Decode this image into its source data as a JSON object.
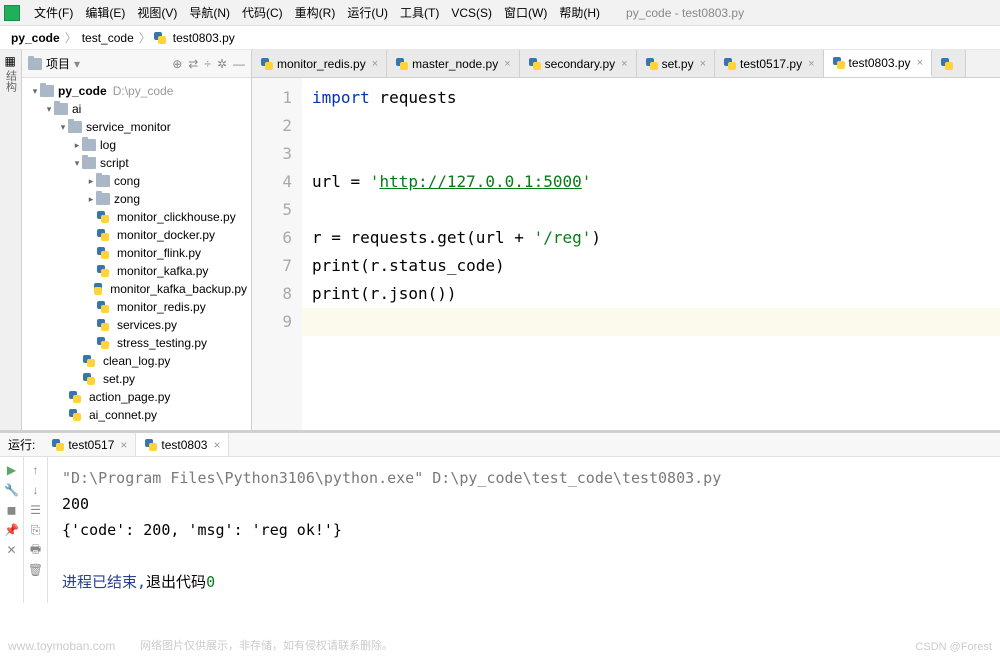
{
  "window_title": "py_code - test0803.py",
  "menu": [
    "文件(F)",
    "编辑(E)",
    "视图(V)",
    "导航(N)",
    "代码(C)",
    "重构(R)",
    "运行(U)",
    "工具(T)",
    "VCS(S)",
    "窗口(W)",
    "帮助(H)"
  ],
  "breadcrumbs": {
    "root": "py_code",
    "mid": "test_code",
    "file": "test0803.py"
  },
  "sidebar": {
    "title": "项目",
    "root_label": "py_code",
    "root_hint": "D:\\py_code",
    "rows": [
      {
        "pad": 1,
        "arrow": "▾",
        "type": "folder",
        "label": "ai"
      },
      {
        "pad": 2,
        "arrow": "▾",
        "type": "folder",
        "label": "service_monitor"
      },
      {
        "pad": 3,
        "arrow": "▸",
        "type": "folder",
        "label": "log"
      },
      {
        "pad": 3,
        "arrow": "▾",
        "type": "folder",
        "label": "script"
      },
      {
        "pad": 4,
        "arrow": "▸",
        "type": "folder",
        "label": "cong"
      },
      {
        "pad": 4,
        "arrow": "▸",
        "type": "folder",
        "label": "zong"
      },
      {
        "pad": 4,
        "arrow": "",
        "type": "py",
        "label": "monitor_clickhouse.py"
      },
      {
        "pad": 4,
        "arrow": "",
        "type": "py",
        "label": "monitor_docker.py"
      },
      {
        "pad": 4,
        "arrow": "",
        "type": "py",
        "label": "monitor_flink.py"
      },
      {
        "pad": 4,
        "arrow": "",
        "type": "py",
        "label": "monitor_kafka.py"
      },
      {
        "pad": 4,
        "arrow": "",
        "type": "py",
        "label": "monitor_kafka_backup.py"
      },
      {
        "pad": 4,
        "arrow": "",
        "type": "py",
        "label": "monitor_redis.py"
      },
      {
        "pad": 4,
        "arrow": "",
        "type": "py",
        "label": "services.py"
      },
      {
        "pad": 4,
        "arrow": "",
        "type": "py",
        "label": "stress_testing.py"
      },
      {
        "pad": 3,
        "arrow": "",
        "type": "py",
        "label": "clean_log.py"
      },
      {
        "pad": 3,
        "arrow": "",
        "type": "py",
        "label": "set.py"
      },
      {
        "pad": 2,
        "arrow": "",
        "type": "py",
        "label": "action_page.py"
      },
      {
        "pad": 2,
        "arrow": "",
        "type": "py",
        "label": "ai_connet.py"
      }
    ]
  },
  "tabs": [
    {
      "label": "monitor_redis.py",
      "active": false
    },
    {
      "label": "master_node.py",
      "active": false
    },
    {
      "label": "secondary.py",
      "active": false
    },
    {
      "label": "set.py",
      "active": false
    },
    {
      "label": "test0517.py",
      "active": false
    },
    {
      "label": "test0803.py",
      "active": true
    }
  ],
  "code": {
    "lines": [
      "1",
      "2",
      "3",
      "4",
      "5",
      "6",
      "7",
      "8",
      "9"
    ],
    "l1_kw": "import",
    "l1_rest": " requests",
    "l4_pre": "url = ",
    "l4_q": "'",
    "l4_url": "http://127.0.0.1:5000",
    "l6_pre": "r = requests.get(url + ",
    "l6_str": "'/reg'",
    "l6_post": ")",
    "l7_fn": "print",
    "l7_arg": "(r.status_code)",
    "l8_fn": "print",
    "l8_arg": "(r.json())"
  },
  "run": {
    "label": "运行:",
    "tabs": [
      {
        "label": "test0517",
        "active": false
      },
      {
        "label": "test0803",
        "active": true
      }
    ],
    "cmd": "\"D:\\Program Files\\Python3106\\python.exe\" D:\\py_code\\test_code\\test0803.py",
    "out1": "200",
    "out2": "{'code': 200, 'msg': 'reg ok!'}",
    "exit_pre": "进程已结束,",
    "exit_mid": "退出代码",
    "exit_code": "0"
  },
  "watermark": "www.toymoban.com",
  "watermark2": "网络图片仅供展示，非存储，如有侵权请联系删除。",
  "csdn": "CSDN @Forest"
}
